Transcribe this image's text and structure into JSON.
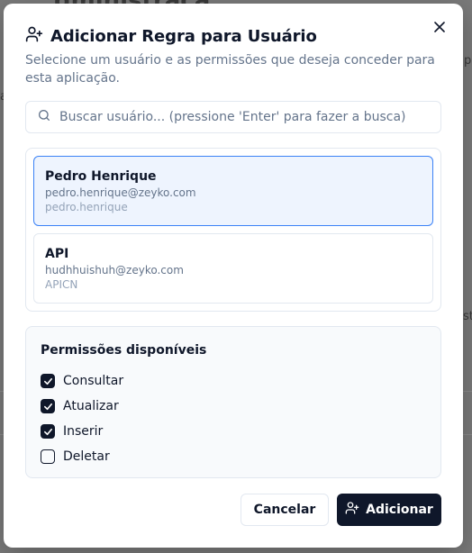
{
  "background": {
    "fragments": [
      "dministraçã",
      "a",
      "p",
      "st"
    ]
  },
  "dialog": {
    "title": "Adicionar Regra para Usuário",
    "title_icon": "user-plus-icon",
    "close_icon": "close-icon",
    "subtitle": "Selecione um usuário e as permissões que deseja conceder para esta aplicação."
  },
  "search": {
    "icon": "search-icon",
    "value": "",
    "placeholder": "Buscar usuário... (pressione 'Enter' para fazer a busca)"
  },
  "users": [
    {
      "name": "Pedro Henrique",
      "email": "pedro.henrique@zeyko.com",
      "login": "pedro.henrique",
      "selected": true
    },
    {
      "name": "API",
      "email": "hudhhuishuh@zeyko.com",
      "login": "APICN",
      "selected": false
    }
  ],
  "permissions": {
    "title": "Permissões disponíveis",
    "items": [
      {
        "label": "Consultar",
        "checked": true
      },
      {
        "label": "Atualizar",
        "checked": true
      },
      {
        "label": "Inserir",
        "checked": true
      },
      {
        "label": "Deletar",
        "checked": false
      }
    ]
  },
  "actions": {
    "cancel_label": "Cancelar",
    "add_label": "Adicionar",
    "add_icon": "user-plus-icon"
  },
  "colors": {
    "overlay": "#7a7a7a",
    "primary": "#0f172a",
    "selected_bg": "#eef4fe",
    "selected_border": "#3b82f6",
    "muted_text": "#64748b"
  }
}
